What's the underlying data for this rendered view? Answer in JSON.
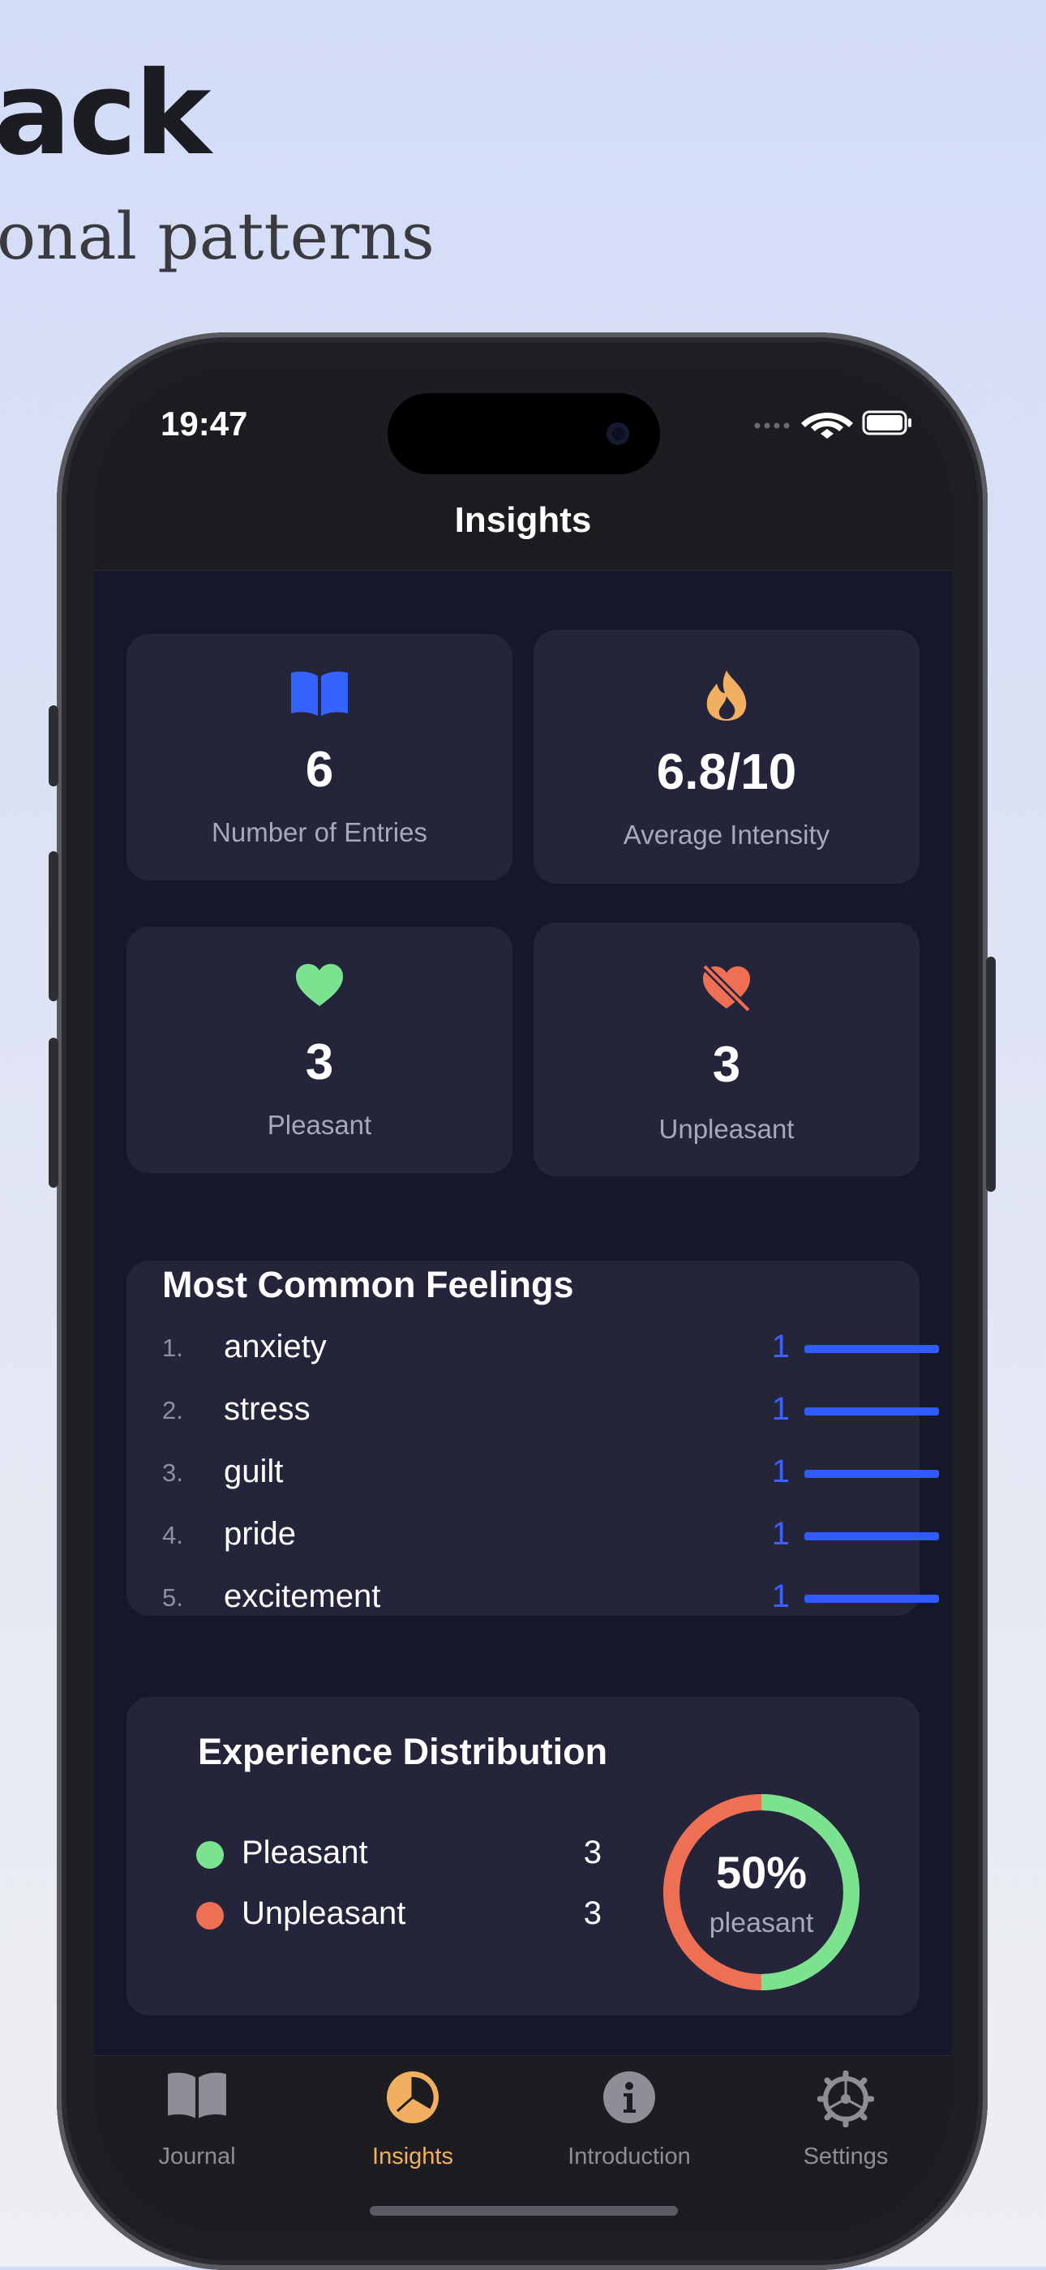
{
  "promo": {
    "title": "ack",
    "subtitle": "onal patterns"
  },
  "status_bar": {
    "time": "19:47"
  },
  "nav": {
    "title": "Insights"
  },
  "stats": {
    "entries": {
      "value": "6",
      "label": "Number of Entries",
      "icon": "book-icon"
    },
    "intensity": {
      "value": "6.8/10",
      "label": "Average Intensity",
      "icon": "flame-icon"
    },
    "pleasant": {
      "value": "3",
      "label": "Pleasant",
      "icon": "heart-icon"
    },
    "unpleasant": {
      "value": "3",
      "label": "Unpleasant",
      "icon": "heart-slash-icon"
    }
  },
  "feelings": {
    "title": "Most Common Feelings",
    "items": [
      {
        "rank": "1.",
        "name": "anxiety",
        "count": "1"
      },
      {
        "rank": "2.",
        "name": "stress",
        "count": "1"
      },
      {
        "rank": "3.",
        "name": "guilt",
        "count": "1"
      },
      {
        "rank": "4.",
        "name": "pride",
        "count": "1"
      },
      {
        "rank": "5.",
        "name": "excitement",
        "count": "1"
      }
    ]
  },
  "distribution": {
    "title": "Experience Distribution",
    "legend": [
      {
        "label": "Pleasant",
        "value": "3",
        "color": "#7be38f"
      },
      {
        "label": "Unpleasant",
        "value": "3",
        "color": "#ef6f55"
      }
    ],
    "percent": "50%",
    "percent_label": "pleasant",
    "pleasant_fraction": 0.5
  },
  "tabs": [
    {
      "label": "Journal",
      "icon": "book-icon",
      "active": false
    },
    {
      "label": "Insights",
      "icon": "pie-chart-icon",
      "active": true
    },
    {
      "label": "Introduction",
      "icon": "info-icon",
      "active": false
    },
    {
      "label": "Settings",
      "icon": "gear-icon",
      "active": false
    }
  ],
  "colors": {
    "accent": "#f0b060",
    "bar": "#2f5bff",
    "pleasant": "#7be38f",
    "unpleasant": "#ef6f55"
  }
}
